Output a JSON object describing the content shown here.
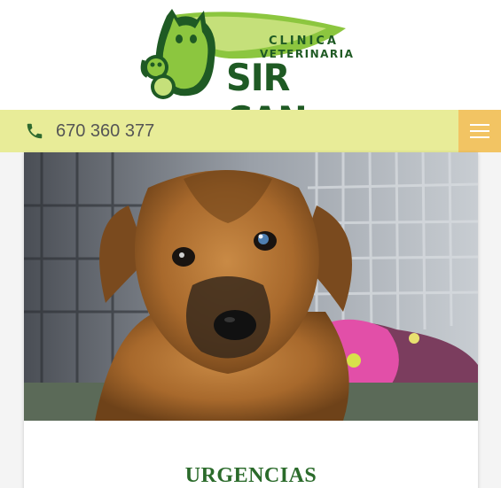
{
  "header": {
    "logo": {
      "line1": "CLINICA",
      "line2": "VETERINARIA",
      "brand": "SIR CAN"
    }
  },
  "topbar": {
    "phone_icon": "phone-icon",
    "phone_number": "670 360 377",
    "menu_icon": "hamburger-menu-icon"
  },
  "card": {
    "image": "puppy-photo",
    "title": "URGENCIAS"
  },
  "colors": {
    "brand_green": "#1f5a24",
    "light_green": "#8cc63f",
    "topbar_bg": "#e8ec98",
    "menu_bg": "#f2c463",
    "title_green": "#2b6b2b"
  }
}
